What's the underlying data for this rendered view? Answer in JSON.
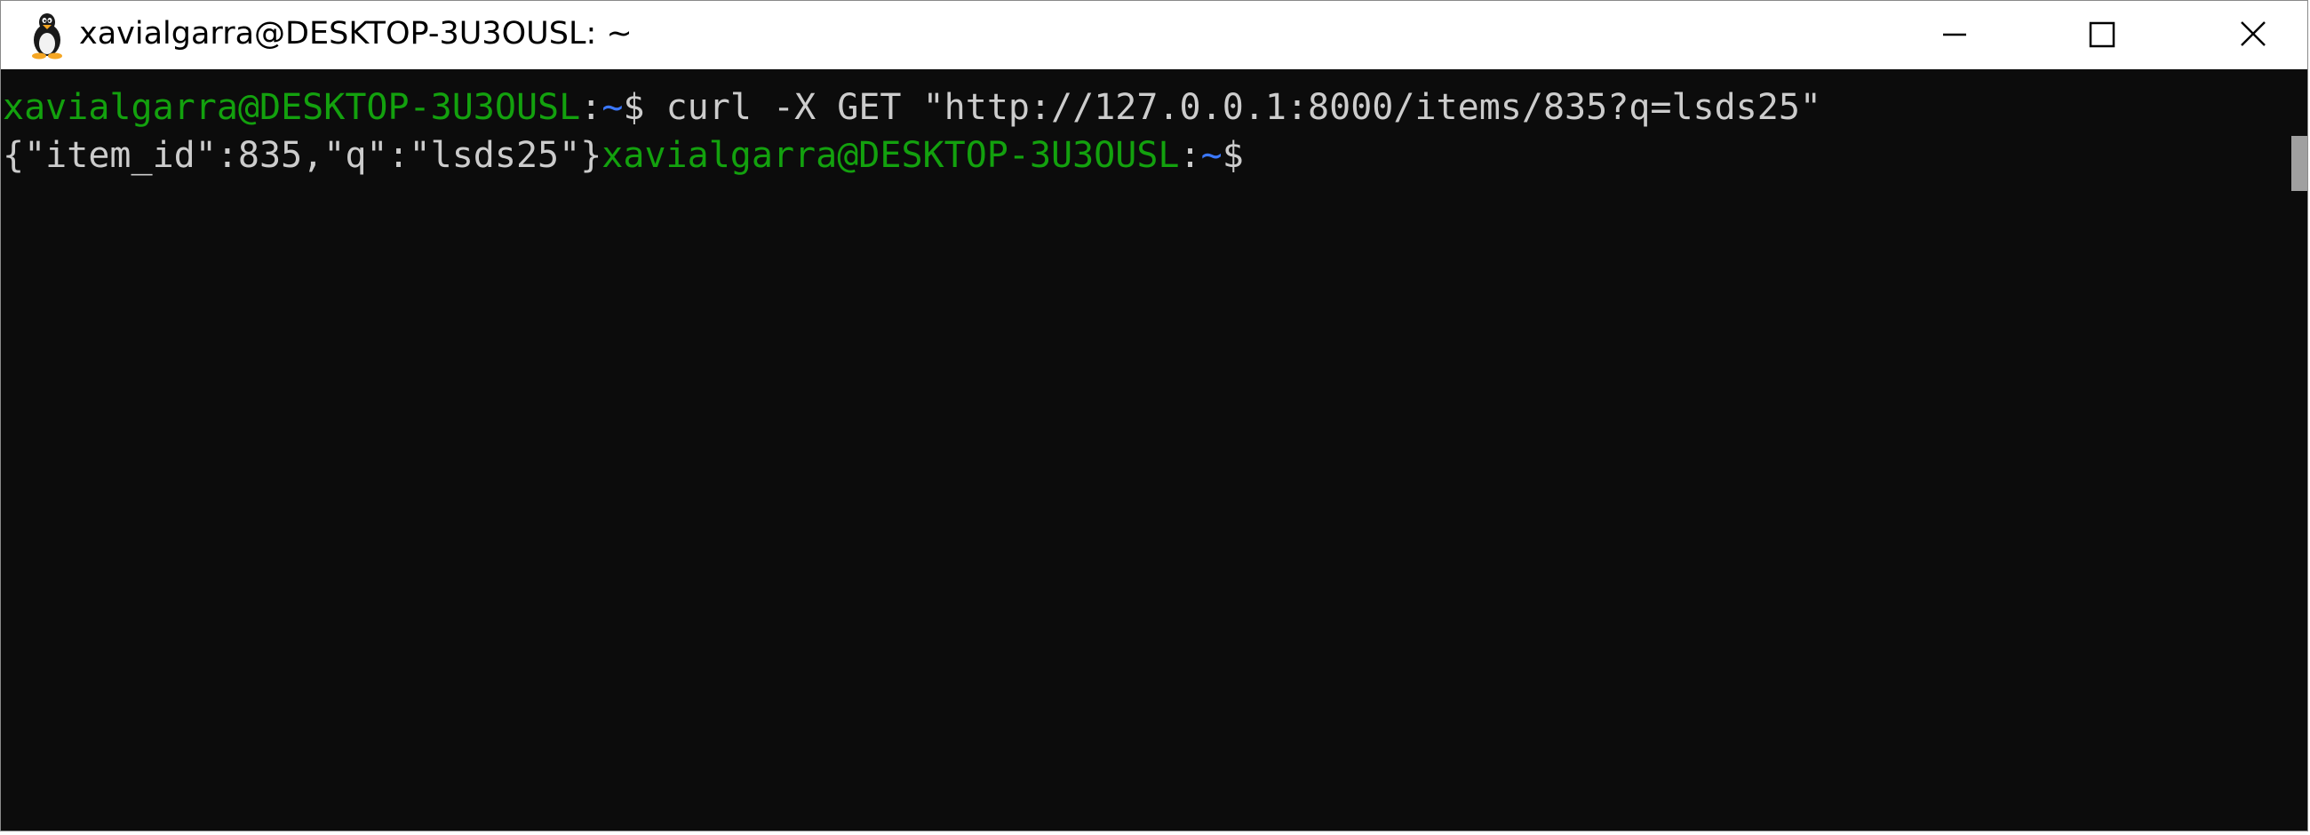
{
  "window": {
    "title": "xavialgarra@DESKTOP-3U3OUSL: ~",
    "app_icon": "linux-penguin-icon",
    "controls": {
      "minimize_icon": "minimize-icon",
      "maximize_icon": "maximize-icon",
      "close_icon": "close-icon"
    }
  },
  "terminal": {
    "line1": {
      "user_host": "xavialgarra@DESKTOP-3U3OUSL",
      "colon": ":",
      "path": "~",
      "prompt": "$",
      "command": " curl -X GET \"http://127.0.0.1:8000/items/835?q=lsds25\""
    },
    "line2": {
      "output": "{\"item_id\":835,\"q\":\"lsds25\"}",
      "user_host": "xavialgarra@DESKTOP-3U3OUSL",
      "colon": ":",
      "path": "~",
      "prompt": "$"
    }
  },
  "colors": {
    "background": "#0c0c0c",
    "text": "#cccccc",
    "user_host": "#13a10e",
    "path": "#3b78ff",
    "titlebar": "#ffffff"
  }
}
